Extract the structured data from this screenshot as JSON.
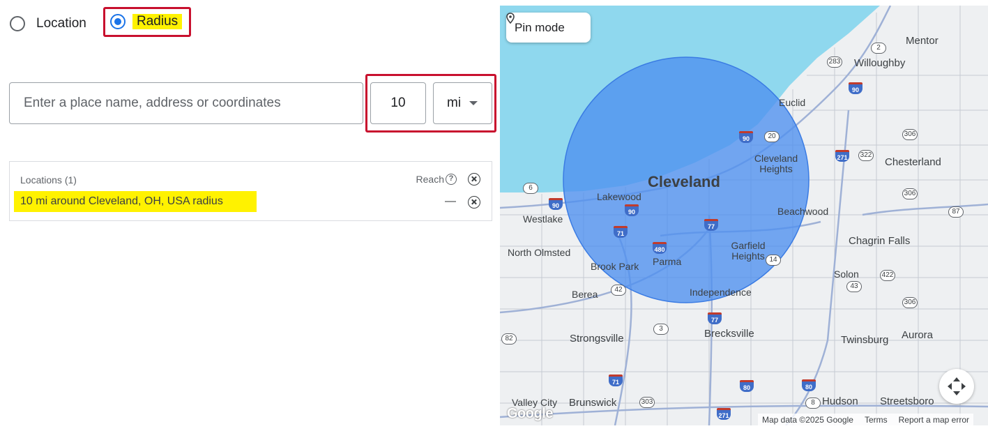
{
  "radio": {
    "location_label": "Location",
    "radius_label": "Radius",
    "selected": "radius"
  },
  "search": {
    "placeholder": "Enter a place name, address or coordinates",
    "value": ""
  },
  "radius": {
    "value": "10",
    "unit": "mi"
  },
  "locations": {
    "title": "Locations (1)",
    "reach_label": "Reach",
    "items": [
      {
        "label": "10 mi around Cleveland, OH, USA radius",
        "reach": "—"
      }
    ]
  },
  "map": {
    "pin_mode_label": "Pin mode",
    "places": {
      "cleveland": "Cleveland",
      "mentor": "Mentor",
      "willoughby": "Willoughby",
      "euclid": "Euclid",
      "cleveland_heights": "Cleveland Heights",
      "chesterland": "Chesterland",
      "lakewood": "Lakewood",
      "beachwood": "Beachwood",
      "westlake": "Westlake",
      "north_olmsted": "North Olmsted",
      "brook_park": "Brook Park",
      "parma": "Parma",
      "garfield_heights": "Garfield Heights",
      "chagrin_falls": "Chagrin Falls",
      "solon": "Solon",
      "berea": "Berea",
      "independence": "Independence",
      "strongsville": "Strongsville",
      "brecksville": "Brecksville",
      "twinsburg": "Twinsburg",
      "aurora": "Aurora",
      "valley_city": "Valley City",
      "brunswick": "Brunswick",
      "hudson": "Hudson",
      "streetsboro": "Streetsboro"
    },
    "shields": {
      "i90a": "90",
      "i90b": "90",
      "i90c": "90",
      "i90d": "90",
      "i271a": "271",
      "i271b": "271",
      "i71a": "71",
      "i71b": "71",
      "i480": "480",
      "i77a": "77",
      "i77b": "77",
      "i80a": "80",
      "i80b": "80",
      "s2": "2",
      "s283": "283",
      "s20": "20",
      "s322": "322",
      "s306a": "306",
      "s306b": "306",
      "s306c": "306",
      "s87": "87",
      "s6": "6",
      "s42": "42",
      "s14": "14",
      "s43": "43",
      "s422": "422",
      "s3": "3",
      "s82": "82",
      "s303": "303",
      "s8": "8"
    },
    "logo": "Google",
    "attribution": {
      "data": "Map data ©2025 Google",
      "terms": "Terms",
      "report": "Report a map error"
    },
    "colors": {
      "water": "#8fd8ee",
      "radius_fill": "#4e8ff0",
      "annotation_red": "#c8102e",
      "highlight": "#fff200",
      "accent": "#1a73e8"
    }
  }
}
